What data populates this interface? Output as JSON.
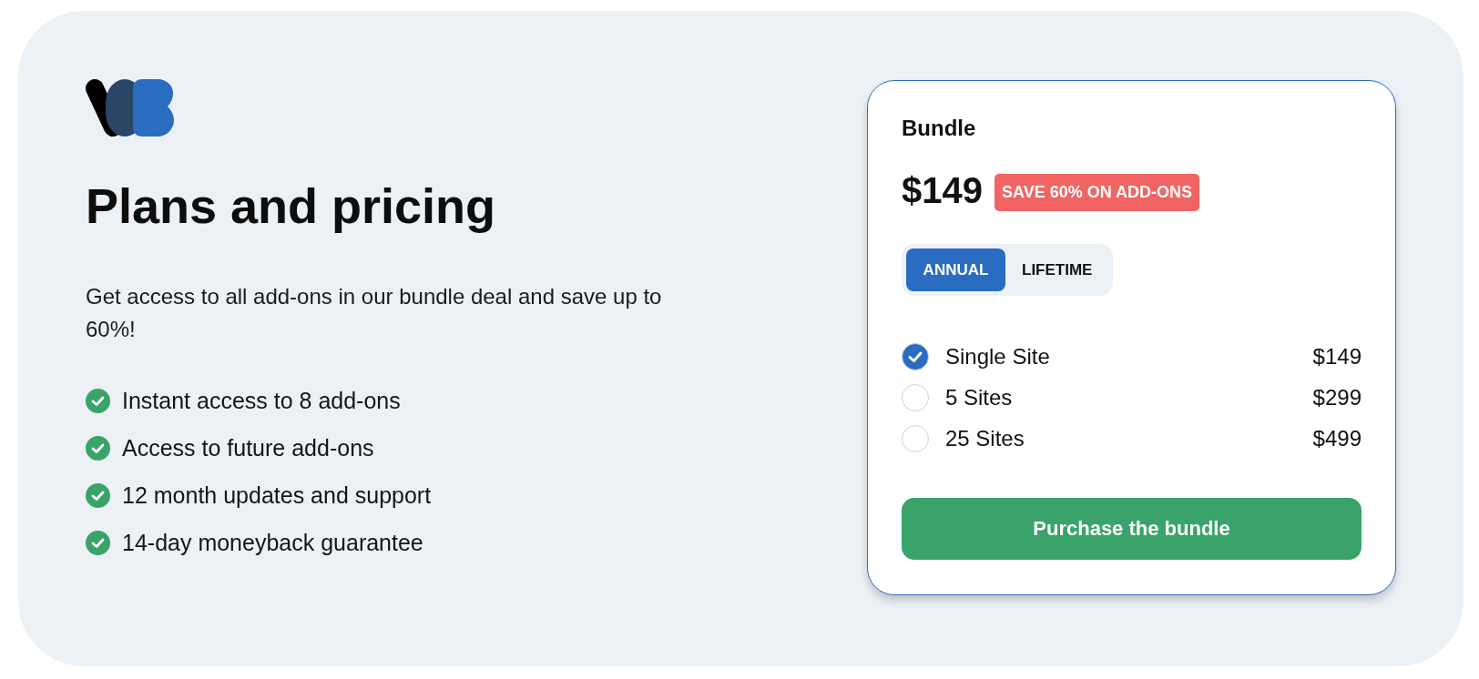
{
  "hero": {
    "title": "Plans and pricing",
    "description": "Get access to all add-ons in our bundle deal and save up to 60%!",
    "features": [
      "Instant access to 8 add-ons",
      "Access to future add-ons",
      "12 month updates and support",
      "14-day moneyback guarantee"
    ]
  },
  "card": {
    "title": "Bundle",
    "price": "$149",
    "badge": "SAVE 60% ON ADD-ONS",
    "billing_tabs": [
      {
        "label": "ANNUAL",
        "selected": true
      },
      {
        "label": "LIFETIME",
        "selected": false
      }
    ],
    "options": [
      {
        "label": "Single Site",
        "price": "$149",
        "selected": true
      },
      {
        "label": "5 Sites",
        "price": "$299",
        "selected": false
      },
      {
        "label": "25 Sites",
        "price": "$499",
        "selected": false
      }
    ],
    "button": "Purchase the bundle"
  }
}
